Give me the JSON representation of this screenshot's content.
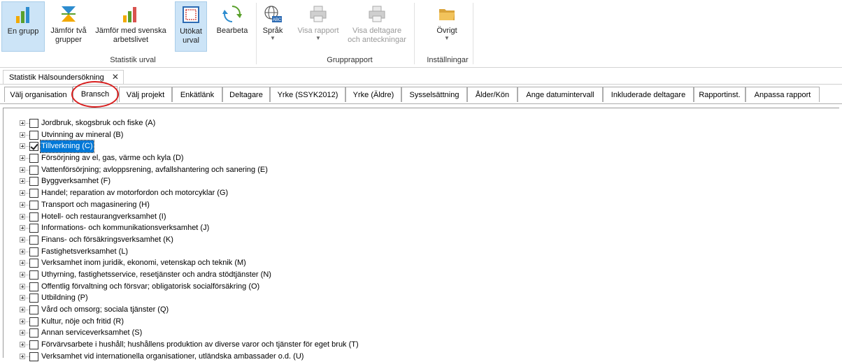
{
  "ribbon": {
    "buttons": [
      {
        "label1": "En grupp",
        "label2": ""
      },
      {
        "label1": "Jämför två",
        "label2": "grupper"
      },
      {
        "label1": "Jämför med svenska",
        "label2": "arbetslivet"
      },
      {
        "label1": "Utökat",
        "label2": "urval"
      },
      {
        "label1": "Bearbeta",
        "label2": ""
      },
      {
        "label1": "Språk",
        "label2": ""
      },
      {
        "label1": "Visa rapport",
        "label2": ""
      },
      {
        "label1": "Visa deltagare",
        "label2": "och anteckningar"
      },
      {
        "label1": "Övrigt",
        "label2": ""
      }
    ],
    "groups": [
      "Statistik urval",
      "Grupprapport",
      "Inställningar"
    ],
    "abc_badge": "ABC"
  },
  "doc_tab": {
    "title": "Statistik Hälsoundersökning",
    "close": "✕"
  },
  "tabs": [
    "Välj organisation",
    "Bransch",
    "Välj projekt",
    "Enkätlänk",
    "Deltagare",
    "Yrke (SSYK2012)",
    "Yrke (Äldre)",
    "Sysselsättning",
    "Ålder/Kön",
    "Ange datumintervall",
    "Inkluderade deltagare",
    "Rapportinst.",
    "Anpassa rapport"
  ],
  "selected_tab": "Bransch",
  "tree": [
    {
      "label": "Jordbruk, skogsbruk och fiske (A)",
      "checked": false
    },
    {
      "label": "Utvinning av mineral (B)",
      "checked": false
    },
    {
      "label": "Tillverkning (C)",
      "checked": true,
      "selected": true
    },
    {
      "label": "Försörjning av el, gas, värme och kyla (D)",
      "checked": false
    },
    {
      "label": "Vattenförsörjning; avloppsrening, avfallshantering och sanering (E)",
      "checked": false
    },
    {
      "label": "Byggverksamhet (F)",
      "checked": false
    },
    {
      "label": "Handel; reparation av motorfordon och motorcyklar (G)",
      "checked": false
    },
    {
      "label": "Transport och magasinering (H)",
      "checked": false
    },
    {
      "label": "Hotell- och restaurangverksamhet (I)",
      "checked": false
    },
    {
      "label": "Informations- och kommunikationsverksamhet (J)",
      "checked": false
    },
    {
      "label": "Finans- och försäkringsverksamhet (K)",
      "checked": false
    },
    {
      "label": "Fastighetsverksamhet (L)",
      "checked": false
    },
    {
      "label": "Verksamhet inom juridik, ekonomi, vetenskap och teknik (M)",
      "checked": false
    },
    {
      "label": "Uthyrning, fastighetsservice, resetjänster och andra stödtjänster (N)",
      "checked": false
    },
    {
      "label": "Offentlig förvaltning och försvar; obligatorisk socialförsäkring (O)",
      "checked": false
    },
    {
      "label": "Utbildning (P)",
      "checked": false
    },
    {
      "label": "Vård och omsorg; sociala tjänster (Q)",
      "checked": false
    },
    {
      "label": "Kultur, nöje och fritid (R)",
      "checked": false
    },
    {
      "label": "Annan serviceverksamhet (S)",
      "checked": false
    },
    {
      "label": "Förvärvsarbete i hushåll; hushållens produktion av diverse varor och tjänster för eget bruk (T)",
      "checked": false
    },
    {
      "label": "Verksamhet vid internationella organisationer, utländska ambassader o.d. (U)",
      "checked": false
    }
  ],
  "colors": {
    "accent": "#0078d7",
    "highlight_circle": "#d81e1e",
    "active_button": "#cce4f7"
  }
}
